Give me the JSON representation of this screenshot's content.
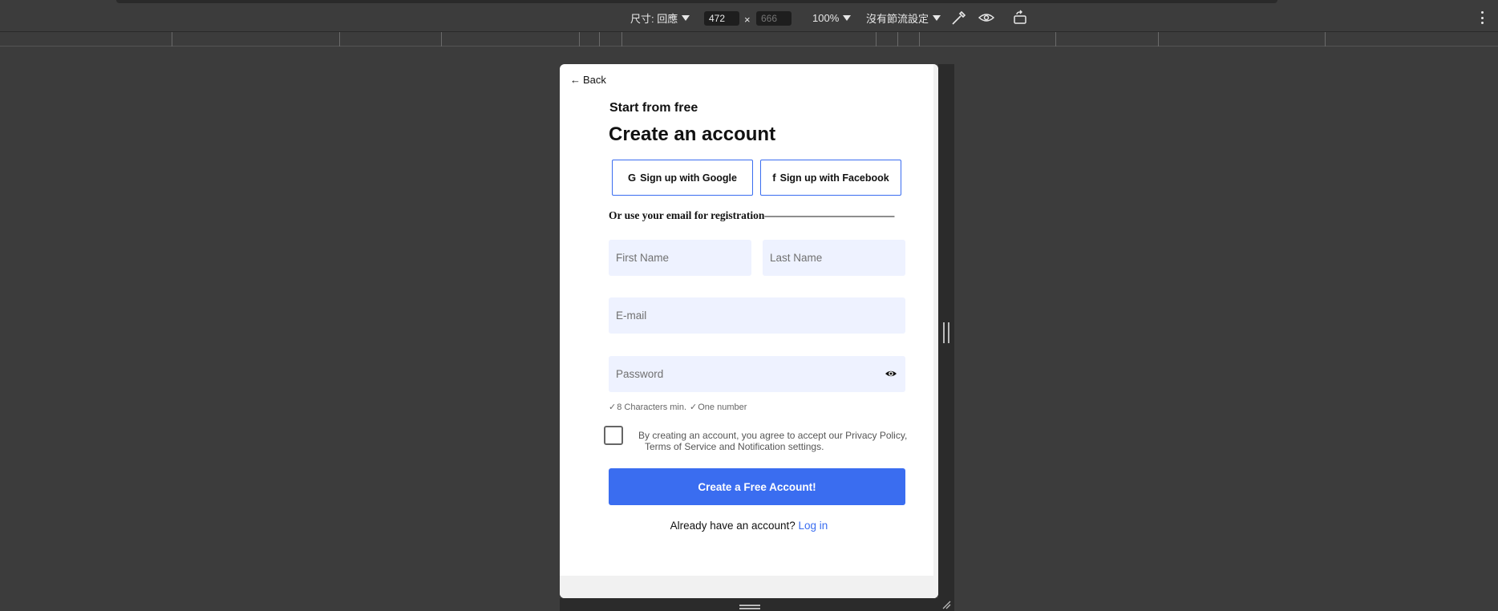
{
  "devtools": {
    "dimensions_label": "尺寸: 回應",
    "width_value": "472",
    "height_placeholder": "666",
    "times_sign": "×",
    "zoom": "100%",
    "throttle": "沒有節流設定",
    "icons": [
      "color-picker-icon",
      "eye-icon",
      "rotate-device-icon",
      "more-menu-icon"
    ]
  },
  "page": {
    "back_label": "Back",
    "back_arrow": "←",
    "subtitle": "Start from free",
    "title": "Create an account",
    "google_label": "Sign up with Google",
    "google_icon": "G",
    "facebook_label": "Sign up with Facebook",
    "facebook_icon": "f",
    "or_line": "Or use your email for registration————————————",
    "first_name_placeholder": "First Name",
    "last_name_placeholder": "Last Name",
    "email_placeholder": "E-mail",
    "password_placeholder": "Password",
    "rule_chars": "8 Characters min.",
    "rule_number": "One number",
    "agree_line1": "By creating an account, you agree to accept our Privacy Policy,",
    "agree_line2": "Terms of Service and Notification settings.",
    "cta_label": "Create a Free Account!",
    "login_prompt": "Already have an account? ",
    "login_link": "Log in"
  },
  "colors": {
    "accent": "#3a6df0",
    "field_bg": "#eef2ff",
    "devtools_bg": "#3c3c3c"
  }
}
